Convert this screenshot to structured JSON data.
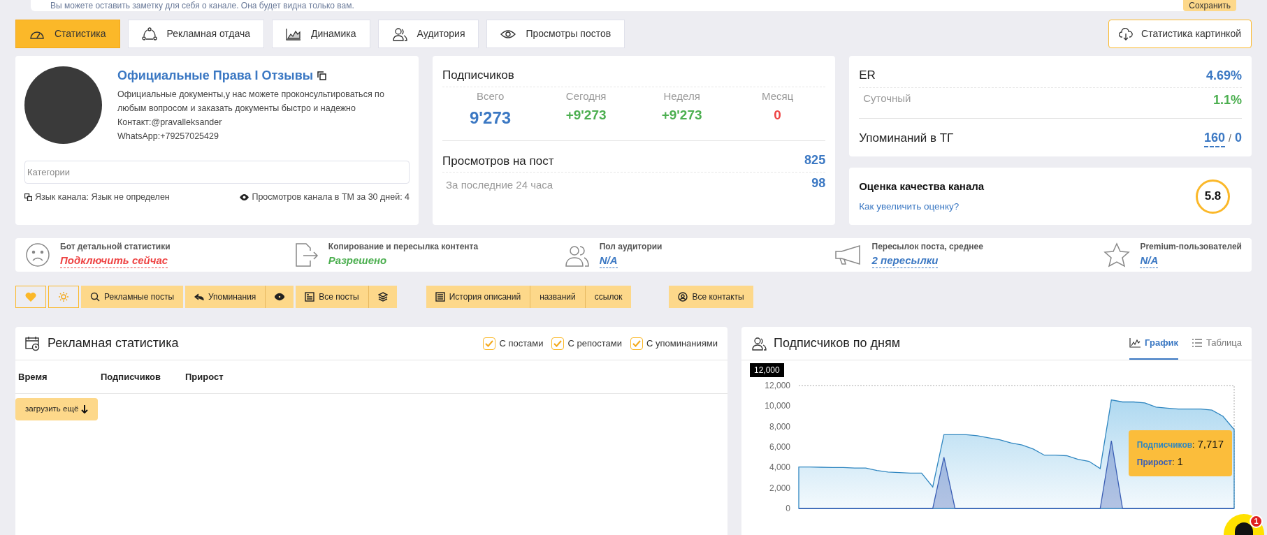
{
  "note_bar": {
    "text": "Вы можете оставить заметку для себя о канале. Она будет видна только вам.",
    "save_button": "Сохранить"
  },
  "tabs": [
    {
      "label": "Статистика",
      "selected": true
    },
    {
      "label": "Рекламная отдача",
      "selected": false
    },
    {
      "label": "Динамика",
      "selected": false
    },
    {
      "label": "Аудитория",
      "selected": false
    },
    {
      "label": "Просмотры постов",
      "selected": false
    }
  ],
  "image_stats_button": "Статистика картинкой",
  "channel": {
    "title": "Официальные Права I Отзывы",
    "description": [
      "Официальные документы,у нас можете проконсультироваться по любым вопросом и заказать документы быстро и надежно",
      "Контакт:@pravalleksander",
      "WhatsApp:+79257025429"
    ],
    "categories_placeholder": "Категории",
    "language": "Язык канала: Язык не определен",
    "tm_views": "Просмотров канала в ТМ за 30 дней: 4"
  },
  "subscribers": {
    "title": "Подписчиков",
    "columns": [
      {
        "label": "Всего",
        "value": "9'273",
        "color": "#3b78c3"
      },
      {
        "label": "Сегодня",
        "value": "+9'273",
        "color": "#4caf50"
      },
      {
        "label": "Неделя",
        "value": "+9'273",
        "color": "#4caf50"
      },
      {
        "label": "Месяц",
        "value": "0",
        "color": "#ee4444"
      }
    ],
    "views_label": "Просмотров на пост",
    "views_value": "825",
    "last24_label": "За последние 24 часа",
    "last24_value": "98"
  },
  "er": {
    "label": "ER",
    "value": "4.69%",
    "daily_label": "Суточный",
    "daily_value": "1.1%",
    "mentions_label": "Упоминаний в ТГ",
    "mentions_value": "160",
    "mentions_sep": "/",
    "mentions_value_2": "0"
  },
  "quality": {
    "title": "Оценка качества канала",
    "link": "Как увеличить оценку?",
    "score": "5.8"
  },
  "status_items": [
    {
      "title": "Бот детальной статистики",
      "value": "Подключить сейчас",
      "color": "#ee4444",
      "kind": "link"
    },
    {
      "title": "Копирование и пересылка контента",
      "value": "Разрешено",
      "color": "#4caf50",
      "kind": "text"
    },
    {
      "title": "Пол аудитории",
      "value": "N/A",
      "color": "#3b78c3",
      "kind": "link"
    },
    {
      "title": "Пересылок поста, среднее",
      "value": "2 пересылки",
      "color": "#3b78c3",
      "kind": "link"
    },
    {
      "title": "Premium-пользователей",
      "value": "N/A",
      "color": "#3b78c3",
      "kind": "link"
    }
  ],
  "actions": {
    "ads_posts": "Рекламные посты",
    "mentions": "Упоминания",
    "all_posts": "Все посты",
    "history": [
      "История описаний",
      "названий",
      "ссылок"
    ],
    "all_contacts": "Все контакты"
  },
  "ad_stats": {
    "title": "Рекламная статистика",
    "filters": [
      {
        "label": "С постами",
        "checked": true
      },
      {
        "label": "С репостами",
        "checked": true
      },
      {
        "label": "С упоминаниями",
        "checked": true
      }
    ],
    "columns": [
      "Время",
      "Подписчиков",
      "Прирост"
    ],
    "load_more": "загрузить ещё"
  },
  "daily": {
    "title": "Подписчиков по дням",
    "views": [
      {
        "label": "График",
        "selected": true
      },
      {
        "label": "Таблица",
        "selected": false
      }
    ],
    "chart_data": {
      "type": "area",
      "yticks": [
        {
          "value": 0,
          "label": "0"
        },
        {
          "value": 2000,
          "label": "2,000"
        },
        {
          "value": 4000,
          "label": "4,000"
        },
        {
          "value": 6000,
          "label": "6,000"
        },
        {
          "value": 8000,
          "label": "8,000"
        },
        {
          "value": 10000,
          "label": "10,000"
        },
        {
          "value": 12000,
          "label": "12,000"
        }
      ],
      "ylim": [
        0,
        12000
      ],
      "series": [
        {
          "name": "Подписчиков",
          "color": "#2f86c0",
          "values": [
            4050,
            4050,
            4020,
            4000,
            4000,
            3950,
            3950,
            3700,
            3550,
            3500,
            3450,
            3450,
            2100,
            7200,
            7200,
            7200,
            7100,
            6900,
            6700,
            6400,
            6200,
            5800,
            5200,
            5200,
            5150,
            4800,
            4600,
            3900,
            10600,
            10400,
            10400,
            10300,
            9900,
            9800,
            9700,
            9700,
            9700,
            9600,
            9000,
            7700
          ]
        },
        {
          "name": "Прирост",
          "color": "#3b5fb5",
          "values": [
            0,
            0,
            0,
            0,
            0,
            0,
            0,
            0,
            0,
            0,
            0,
            0,
            0,
            5000,
            0,
            0,
            0,
            0,
            0,
            0,
            0,
            0,
            0,
            0,
            0,
            0,
            0,
            0,
            6600,
            0,
            0,
            0,
            0,
            0,
            0,
            0,
            0,
            0,
            0,
            0
          ]
        }
      ]
    },
    "crosshair_label": "12,000",
    "tooltip": [
      {
        "separator": ":",
        "value": "7,717"
      },
      {
        "separator": ":",
        "value": "1"
      }
    ]
  },
  "chat_badge": "1"
}
